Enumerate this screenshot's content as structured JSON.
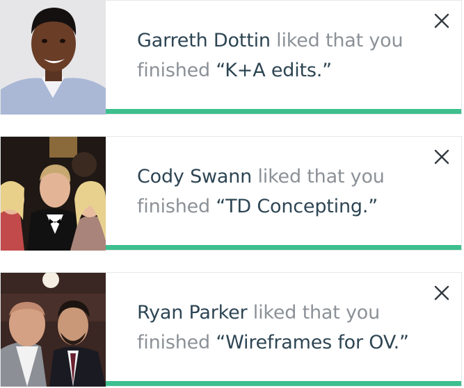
{
  "notifications": [
    {
      "name": "Garreth Dottin",
      "verb": " liked that you",
      "line2_prefix": "finished ",
      "task": "“K+A edits.”",
      "avatar_icon": "user-photo"
    },
    {
      "name": "Cody Swann",
      "verb": " liked that you",
      "line2_prefix": "finished ",
      "task": "“TD Concepting.”",
      "avatar_icon": "user-photo"
    },
    {
      "name": "Ryan Parker",
      "verb": " liked that you",
      "line2_prefix": "finished ",
      "task": "“Wireframes for OV.”",
      "avatar_icon": "user-photo"
    }
  ],
  "icons": {
    "close": "close-icon"
  },
  "colors": {
    "accent_green": "#3dbf8e",
    "name_text": "#2d4553",
    "body_text": "#8b9197"
  }
}
